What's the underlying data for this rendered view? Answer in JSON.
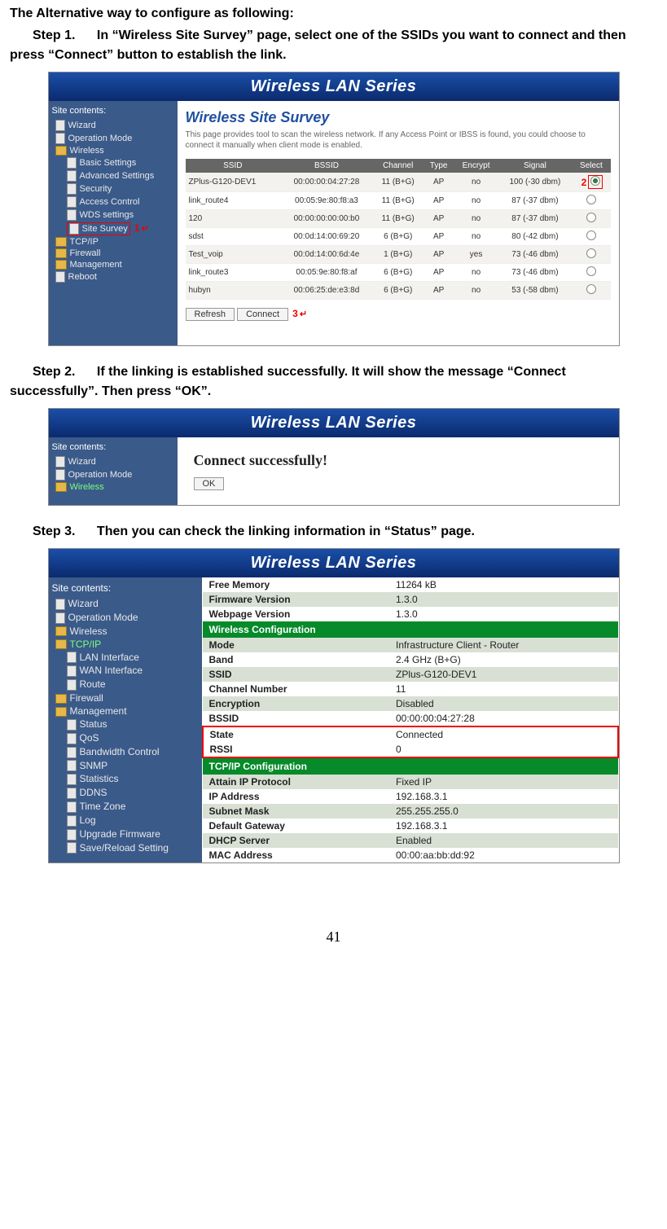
{
  "intro": "The Alternative way to configure as following:",
  "steps": {
    "s1": {
      "label": "Step 1.",
      "text": "In “Wireless Site Survey” page, select one of the SSIDs you want to connect and then press “Connect” button to establish the link."
    },
    "s2": {
      "label": "Step 2.",
      "text": "If the linking is established successfully. It will show the message “Connect successfully”. Then press “OK”."
    },
    "s3": {
      "label": "Step 3.",
      "text": "Then you can check the linking information in “Status” page."
    }
  },
  "header": "Wireless LAN Series",
  "shot1": {
    "sidebarTitle": "Site contents:",
    "nav": {
      "wizard": "Wizard",
      "opmode": "Operation Mode",
      "wireless": "Wireless",
      "basic": "Basic Settings",
      "advanced": "Advanced Settings",
      "security": "Security",
      "access": "Access Control",
      "wds": "WDS settings",
      "survey": "Site Survey",
      "tcpip": "TCP/IP",
      "firewall": "Firewall",
      "mgmt": "Management",
      "reboot": "Reboot"
    },
    "title": "Wireless Site Survey",
    "desc": "This page provides tool to scan the wireless network. If any Access Point or IBSS is found, you could choose to connect it manually when client mode is enabled.",
    "cols": {
      "ssid": "SSID",
      "bssid": "BSSID",
      "ch": "Channel",
      "type": "Type",
      "enc": "Encrypt",
      "sig": "Signal",
      "sel": "Select"
    },
    "rows": [
      {
        "ssid": "ZPlus-G120-DEV1",
        "bssid": "00:00:00:04:27:28",
        "ch": "11 (B+G)",
        "type": "AP",
        "enc": "no",
        "sig": "100 (-30 dbm)"
      },
      {
        "ssid": "link_route4",
        "bssid": "00:05:9e:80:f8:a3",
        "ch": "11 (B+G)",
        "type": "AP",
        "enc": "no",
        "sig": "87 (-37 dbm)"
      },
      {
        "ssid": "120",
        "bssid": "00:00:00:00:00:b0",
        "ch": "11 (B+G)",
        "type": "AP",
        "enc": "no",
        "sig": "87 (-37 dbm)"
      },
      {
        "ssid": "sdst",
        "bssid": "00:0d:14:00:69:20",
        "ch": "6 (B+G)",
        "type": "AP",
        "enc": "no",
        "sig": "80 (-42 dbm)"
      },
      {
        "ssid": "Test_voip",
        "bssid": "00:0d:14:00:6d:4e",
        "ch": "1 (B+G)",
        "type": "AP",
        "enc": "yes",
        "sig": "73 (-46 dbm)"
      },
      {
        "ssid": "link_route3",
        "bssid": "00:05:9e:80:f8:af",
        "ch": "6 (B+G)",
        "type": "AP",
        "enc": "no",
        "sig": "73 (-46 dbm)"
      },
      {
        "ssid": "hubyn",
        "bssid": "00:06:25:de:e3:8d",
        "ch": "6 (B+G)",
        "type": "AP",
        "enc": "no",
        "sig": "53 (-58 dbm)"
      }
    ],
    "btns": {
      "refresh": "Refresh",
      "connect": "Connect"
    },
    "marks": {
      "m1": "1",
      "m2": "2",
      "m3": "3"
    }
  },
  "shot2": {
    "sidebarTitle": "Site contents:",
    "nav": {
      "wizard": "Wizard",
      "opmode": "Operation Mode",
      "wireless": "Wireless"
    },
    "msg": "Connect successfully!",
    "ok": "OK"
  },
  "shot3": {
    "sidebarTitle": "Site contents:",
    "nav": {
      "wizard": "Wizard",
      "opmode": "Operation Mode",
      "wireless": "Wireless",
      "tcpip": "TCP/IP",
      "lan": "LAN Interface",
      "wan": "WAN Interface",
      "route": "Route",
      "firewall": "Firewall",
      "mgmt": "Management",
      "status": "Status",
      "qos": "QoS",
      "bw": "Bandwidth Control",
      "snmp": "SNMP",
      "stats": "Statistics",
      "ddns": "DDNS",
      "tz": "Time Zone",
      "log": "Log",
      "upgrade": "Upgrade Firmware",
      "save": "Save/Reload Setting"
    },
    "rows": {
      "freemem": {
        "k": "Free Memory",
        "v": "11264 kB"
      },
      "fw": {
        "k": "Firmware Version",
        "v": "1.3.0"
      },
      "wp": {
        "k": "Webpage Version",
        "v": "1.3.0"
      },
      "sec1": "Wireless Configuration",
      "mode": {
        "k": "Mode",
        "v": "Infrastructure Client - Router"
      },
      "band": {
        "k": "Band",
        "v": "2.4 GHz (B+G)"
      },
      "ssid": {
        "k": "SSID",
        "v": "ZPlus-G120-DEV1"
      },
      "chn": {
        "k": "Channel Number",
        "v": "11"
      },
      "enc": {
        "k": "Encryption",
        "v": "Disabled"
      },
      "bssid": {
        "k": "BSSID",
        "v": "00:00:00:04:27:28"
      },
      "state": {
        "k": "State",
        "v": "Connected"
      },
      "rssi": {
        "k": "RSSI",
        "v": "0"
      },
      "sec2": "TCP/IP Configuration",
      "attain": {
        "k": "Attain IP Protocol",
        "v": "Fixed IP"
      },
      "ip": {
        "k": "IP Address",
        "v": "192.168.3.1"
      },
      "mask": {
        "k": "Subnet Mask",
        "v": "255.255.255.0"
      },
      "gw": {
        "k": "Default Gateway",
        "v": "192.168.3.1"
      },
      "dhcp": {
        "k": "DHCP Server",
        "v": "Enabled"
      },
      "mac": {
        "k": "MAC Address",
        "v": "00:00:aa:bb:dd:92"
      }
    }
  },
  "pageNum": "41"
}
